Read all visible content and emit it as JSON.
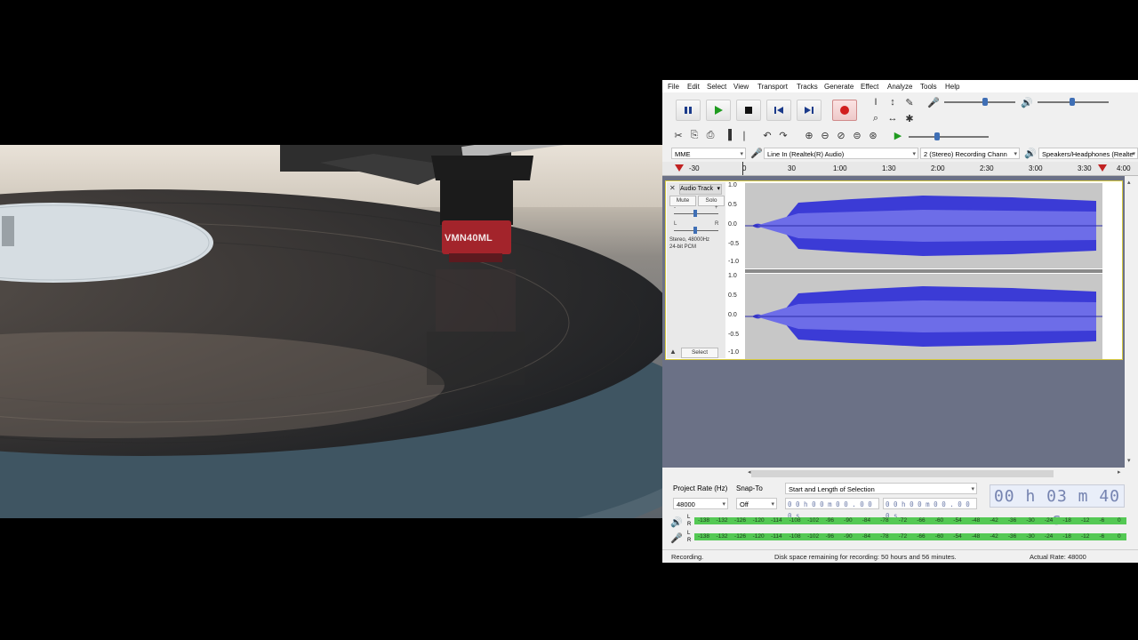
{
  "video": {
    "cartridge_label": "VMN40ML"
  },
  "audacity": {
    "menu": [
      "File",
      "Edit",
      "Select",
      "View",
      "Transport",
      "Tracks",
      "Generate",
      "Effect",
      "Analyze",
      "Tools",
      "Help"
    ],
    "host": "MME",
    "recording_device": "Line In (Realtek(R) Audio)",
    "channels": "2 (Stereo) Recording Chann",
    "playback_device": "Speakers/Headphones (Realte",
    "timeline_labels": [
      "-30",
      "0",
      "30",
      "1:00",
      "1:30",
      "2:00",
      "2:30",
      "3:00",
      "3:30",
      "4:00"
    ],
    "track": {
      "name": "Audio Track",
      "mute": "Mute",
      "solo": "Solo",
      "gain_minus": "-",
      "gain_plus": "+",
      "pan_left": "L",
      "pan_right": "R",
      "info_line1": "Stereo, 48000Hz",
      "info_line2": "24-bit PCM",
      "select": "Select"
    },
    "vruler_ticks": [
      "1.0",
      "0.5",
      "0.0",
      "-0.5",
      "-1.0"
    ],
    "selection_toolbar": {
      "project_rate_label": "Project Rate (Hz)",
      "project_rate_value": "48000",
      "snap_to_label": "Snap-To",
      "snap_to_value": "Off",
      "selection_mode": "Start and Length of Selection",
      "start_time": "0 0 h 0 0 m 0 0 . 0 0 0 s",
      "length_time": "0 0 h 0 0 m 0 0 . 0 0 0 s",
      "audio_position": "00 h 03 m 40 s"
    },
    "meter_scale": [
      "-138",
      "-132",
      "-126",
      "-120",
      "-114",
      "-108",
      "-102",
      "-96",
      "-90",
      "-84",
      "-78",
      "-72",
      "-66",
      "-60",
      "-54",
      "-48",
      "-42",
      "-36",
      "-30",
      "-24",
      "-18",
      "-12",
      "-6",
      "0"
    ],
    "meter_channels": [
      "L",
      "R"
    ],
    "status": {
      "state": "Recording.",
      "disk": "Disk space remaining for recording: 50 hours and 56 minutes.",
      "rate": "Actual Rate: 48000"
    }
  }
}
